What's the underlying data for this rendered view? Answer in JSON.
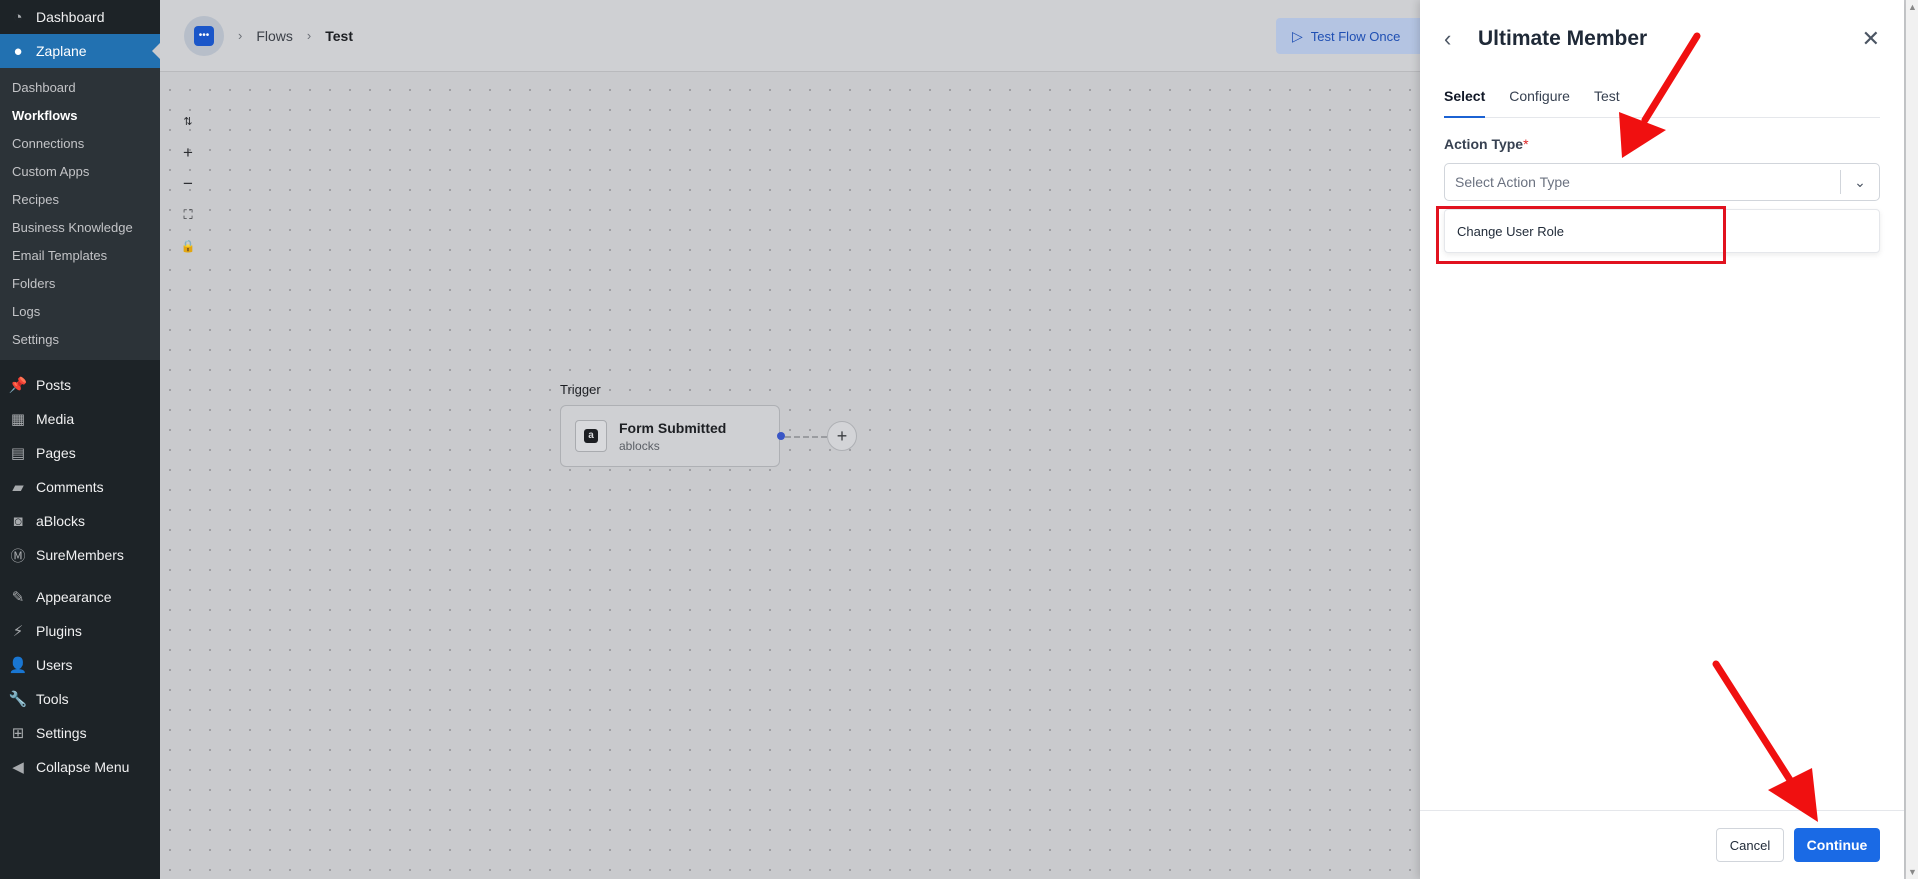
{
  "sidebar": {
    "top_items": [
      {
        "label": "Dashboard",
        "icon": "dashboard-icon"
      },
      {
        "label": "Zaplane",
        "icon": "zaplane-icon"
      }
    ],
    "sub_items": [
      "Dashboard",
      "Workflows",
      "Connections",
      "Custom Apps",
      "Recipes",
      "Business Knowledge",
      "Email Templates",
      "Folders",
      "Logs",
      "Settings"
    ],
    "menu_items": [
      {
        "label": "Posts",
        "icon": "pin-icon"
      },
      {
        "label": "Media",
        "icon": "media-icon"
      },
      {
        "label": "Pages",
        "icon": "pages-icon"
      },
      {
        "label": "Comments",
        "icon": "comments-icon"
      },
      {
        "label": "aBlocks",
        "icon": "ablocks-icon"
      },
      {
        "label": "SureMembers",
        "icon": "suremembers-icon"
      },
      {
        "label": "Appearance",
        "icon": "brush-icon"
      },
      {
        "label": "Plugins",
        "icon": "plug-icon"
      },
      {
        "label": "Users",
        "icon": "user-icon"
      },
      {
        "label": "Tools",
        "icon": "wrench-icon"
      },
      {
        "label": "Settings",
        "icon": "settings-icon"
      },
      {
        "label": "Collapse Menu",
        "icon": "collapse-icon"
      }
    ]
  },
  "breadcrumb": {
    "flows": "Flows",
    "current": "Test"
  },
  "toolbar": {
    "test_flow_once": "Test Flow Once"
  },
  "canvas": {
    "trigger_label": "Trigger",
    "trigger_title": "Form Submitted",
    "trigger_subtitle": "ablocks"
  },
  "panel": {
    "title": "Ultimate Member",
    "tabs": [
      "Select",
      "Configure",
      "Test"
    ],
    "active_tab": "Select",
    "action_type_label": "Action Type",
    "required_mark": "*",
    "select_placeholder": "Select Action Type",
    "dropdown_options": [
      "Change User Role"
    ],
    "cancel_label": "Cancel",
    "continue_label": "Continue"
  },
  "colors": {
    "wp_sidebar": "#1d2327",
    "wp_active": "#2271b1",
    "primary_button": "#1a6ae5",
    "annotation_red": "#e1121f"
  }
}
